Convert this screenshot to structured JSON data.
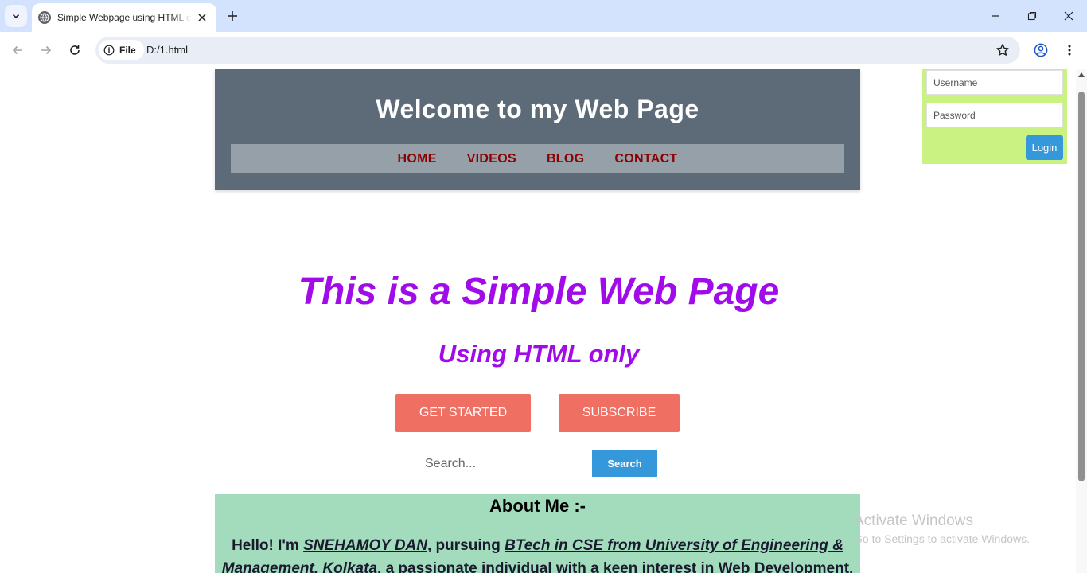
{
  "browser": {
    "tab_title": "Simple Webpage using HTML only",
    "address_chip": "File",
    "url": "D:/1.html"
  },
  "page": {
    "site_title": "Welcome to my Web Page",
    "nav": [
      "HOME",
      "VIDEOS",
      "BLOG",
      "CONTACT"
    ],
    "login": {
      "username_placeholder": "Username",
      "password_placeholder": "Password",
      "button_label": "Login"
    },
    "hero": {
      "title": "This is a Simple Web Page",
      "subtitle": "Using HTML only"
    },
    "buttons": {
      "get_started": "GET STARTED",
      "subscribe": "SUBSCRIBE"
    },
    "search": {
      "placeholder": "Search...",
      "button_label": "Search"
    },
    "about": {
      "title": "About Me :-",
      "text_1": "Hello! I'm ",
      "name": "SNEHAMOY DAN",
      "text_2": ", pursuing ",
      "course": "BTech in CSE from University of Engineering & Management, Kolkata",
      "text_3": ", a passionate individual with a keen interest in Web Development."
    }
  },
  "os": {
    "watermark_title": "Activate Windows",
    "watermark_sub": "Go to Settings to activate Windows."
  },
  "colors": {
    "header_bg": "#5d6b78",
    "nav_bg": "#96a0a8",
    "nav_link": "#8b0000",
    "login_bg": "#c9f283",
    "accent_blue": "#3498db",
    "hero_purple": "#a10bea",
    "cta_coral": "#ef6f63",
    "about_bg": "#a3dcbc"
  }
}
